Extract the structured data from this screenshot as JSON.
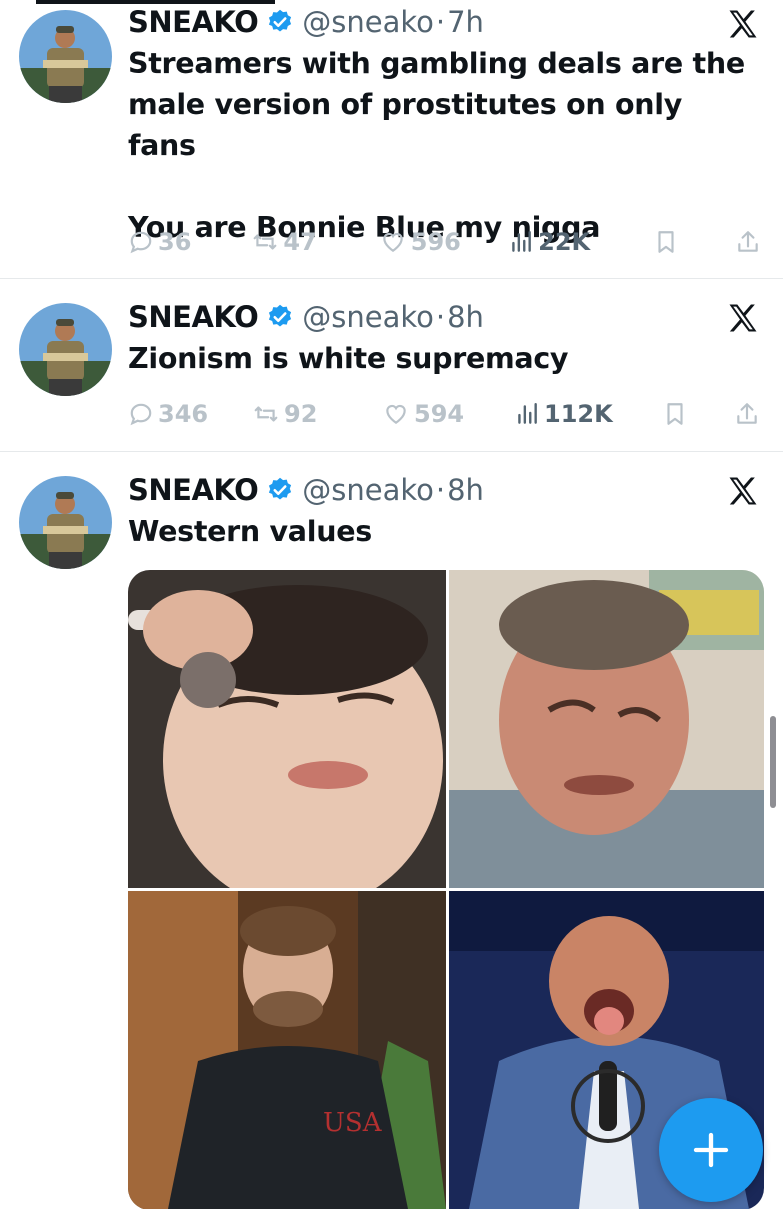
{
  "colors": {
    "verified_badge": "#1d9bf0",
    "secondary_text": "#536471",
    "muted_actions": "#b9c2c9",
    "fab": "#1d9bf0"
  },
  "tweets": [
    {
      "name": "SNEAKO",
      "handle": "@sneako",
      "separator": "·",
      "time": "7h",
      "text": [
        "Streamers with gambling deals are the",
        "male version of prostitutes on only fans",
        "",
        "You are Bonnie Blue my nigga"
      ],
      "replies": "36",
      "reposts": "47",
      "likes": "596",
      "views": "22K"
    },
    {
      "name": "SNEAKO",
      "handle": "@sneako",
      "separator": "·",
      "time": "8h",
      "text": [
        "Zionism is white supremacy"
      ],
      "replies": "346",
      "reposts": "92",
      "likes": "594",
      "views": "112K"
    },
    {
      "name": "SNEAKO",
      "handle": "@sneako",
      "separator": "·",
      "time": "8h",
      "text": [
        "Western values"
      ]
    }
  ],
  "media": [
    {
      "subject": "man-eyes-closed-makeup-photo"
    },
    {
      "subject": "man-grimacing-photo"
    },
    {
      "subject": "man-black-usa-sweater-photo"
    },
    {
      "subject": "man-tongue-out-microphone-photo"
    }
  ],
  "icons": {
    "verified": "verified-badge-icon",
    "platform": "x-logo-icon",
    "reply": "reply-icon",
    "repost": "repost-icon",
    "like": "like-icon",
    "views": "views-icon",
    "bookmark": "bookmark-icon",
    "share": "share-icon",
    "compose": "plus-icon"
  }
}
